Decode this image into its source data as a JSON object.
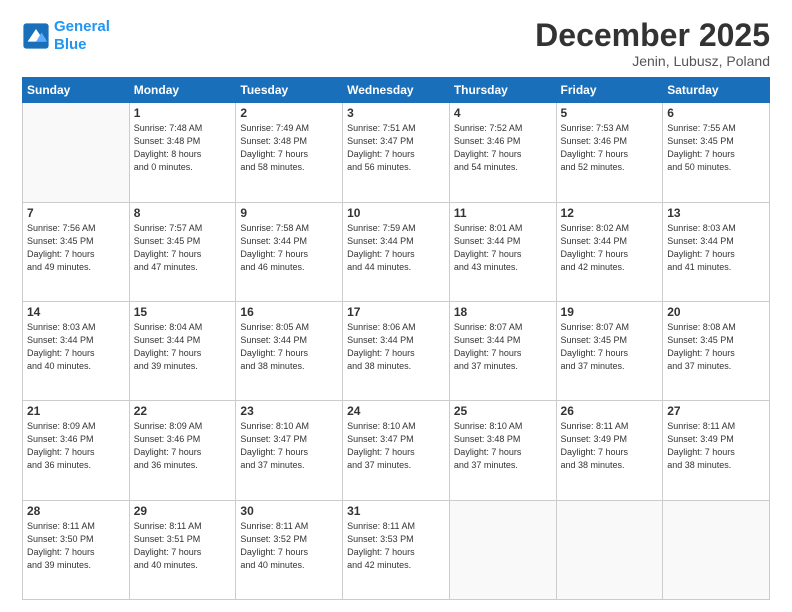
{
  "header": {
    "logo_line1": "General",
    "logo_line2": "Blue",
    "month_title": "December 2025",
    "subtitle": "Jenin, Lubusz, Poland"
  },
  "weekdays": [
    "Sunday",
    "Monday",
    "Tuesday",
    "Wednesday",
    "Thursday",
    "Friday",
    "Saturday"
  ],
  "weeks": [
    [
      {
        "day": "",
        "info": ""
      },
      {
        "day": "1",
        "info": "Sunrise: 7:48 AM\nSunset: 3:48 PM\nDaylight: 8 hours\nand 0 minutes."
      },
      {
        "day": "2",
        "info": "Sunrise: 7:49 AM\nSunset: 3:48 PM\nDaylight: 7 hours\nand 58 minutes."
      },
      {
        "day": "3",
        "info": "Sunrise: 7:51 AM\nSunset: 3:47 PM\nDaylight: 7 hours\nand 56 minutes."
      },
      {
        "day": "4",
        "info": "Sunrise: 7:52 AM\nSunset: 3:46 PM\nDaylight: 7 hours\nand 54 minutes."
      },
      {
        "day": "5",
        "info": "Sunrise: 7:53 AM\nSunset: 3:46 PM\nDaylight: 7 hours\nand 52 minutes."
      },
      {
        "day": "6",
        "info": "Sunrise: 7:55 AM\nSunset: 3:45 PM\nDaylight: 7 hours\nand 50 minutes."
      }
    ],
    [
      {
        "day": "7",
        "info": "Sunrise: 7:56 AM\nSunset: 3:45 PM\nDaylight: 7 hours\nand 49 minutes."
      },
      {
        "day": "8",
        "info": "Sunrise: 7:57 AM\nSunset: 3:45 PM\nDaylight: 7 hours\nand 47 minutes."
      },
      {
        "day": "9",
        "info": "Sunrise: 7:58 AM\nSunset: 3:44 PM\nDaylight: 7 hours\nand 46 minutes."
      },
      {
        "day": "10",
        "info": "Sunrise: 7:59 AM\nSunset: 3:44 PM\nDaylight: 7 hours\nand 44 minutes."
      },
      {
        "day": "11",
        "info": "Sunrise: 8:01 AM\nSunset: 3:44 PM\nDaylight: 7 hours\nand 43 minutes."
      },
      {
        "day": "12",
        "info": "Sunrise: 8:02 AM\nSunset: 3:44 PM\nDaylight: 7 hours\nand 42 minutes."
      },
      {
        "day": "13",
        "info": "Sunrise: 8:03 AM\nSunset: 3:44 PM\nDaylight: 7 hours\nand 41 minutes."
      }
    ],
    [
      {
        "day": "14",
        "info": "Sunrise: 8:03 AM\nSunset: 3:44 PM\nDaylight: 7 hours\nand 40 minutes."
      },
      {
        "day": "15",
        "info": "Sunrise: 8:04 AM\nSunset: 3:44 PM\nDaylight: 7 hours\nand 39 minutes."
      },
      {
        "day": "16",
        "info": "Sunrise: 8:05 AM\nSunset: 3:44 PM\nDaylight: 7 hours\nand 38 minutes."
      },
      {
        "day": "17",
        "info": "Sunrise: 8:06 AM\nSunset: 3:44 PM\nDaylight: 7 hours\nand 38 minutes."
      },
      {
        "day": "18",
        "info": "Sunrise: 8:07 AM\nSunset: 3:44 PM\nDaylight: 7 hours\nand 37 minutes."
      },
      {
        "day": "19",
        "info": "Sunrise: 8:07 AM\nSunset: 3:45 PM\nDaylight: 7 hours\nand 37 minutes."
      },
      {
        "day": "20",
        "info": "Sunrise: 8:08 AM\nSunset: 3:45 PM\nDaylight: 7 hours\nand 37 minutes."
      }
    ],
    [
      {
        "day": "21",
        "info": "Sunrise: 8:09 AM\nSunset: 3:46 PM\nDaylight: 7 hours\nand 36 minutes."
      },
      {
        "day": "22",
        "info": "Sunrise: 8:09 AM\nSunset: 3:46 PM\nDaylight: 7 hours\nand 36 minutes."
      },
      {
        "day": "23",
        "info": "Sunrise: 8:10 AM\nSunset: 3:47 PM\nDaylight: 7 hours\nand 37 minutes."
      },
      {
        "day": "24",
        "info": "Sunrise: 8:10 AM\nSunset: 3:47 PM\nDaylight: 7 hours\nand 37 minutes."
      },
      {
        "day": "25",
        "info": "Sunrise: 8:10 AM\nSunset: 3:48 PM\nDaylight: 7 hours\nand 37 minutes."
      },
      {
        "day": "26",
        "info": "Sunrise: 8:11 AM\nSunset: 3:49 PM\nDaylight: 7 hours\nand 38 minutes."
      },
      {
        "day": "27",
        "info": "Sunrise: 8:11 AM\nSunset: 3:49 PM\nDaylight: 7 hours\nand 38 minutes."
      }
    ],
    [
      {
        "day": "28",
        "info": "Sunrise: 8:11 AM\nSunset: 3:50 PM\nDaylight: 7 hours\nand 39 minutes."
      },
      {
        "day": "29",
        "info": "Sunrise: 8:11 AM\nSunset: 3:51 PM\nDaylight: 7 hours\nand 40 minutes."
      },
      {
        "day": "30",
        "info": "Sunrise: 8:11 AM\nSunset: 3:52 PM\nDaylight: 7 hours\nand 40 minutes."
      },
      {
        "day": "31",
        "info": "Sunrise: 8:11 AM\nSunset: 3:53 PM\nDaylight: 7 hours\nand 42 minutes."
      },
      {
        "day": "",
        "info": ""
      },
      {
        "day": "",
        "info": ""
      },
      {
        "day": "",
        "info": ""
      }
    ]
  ]
}
